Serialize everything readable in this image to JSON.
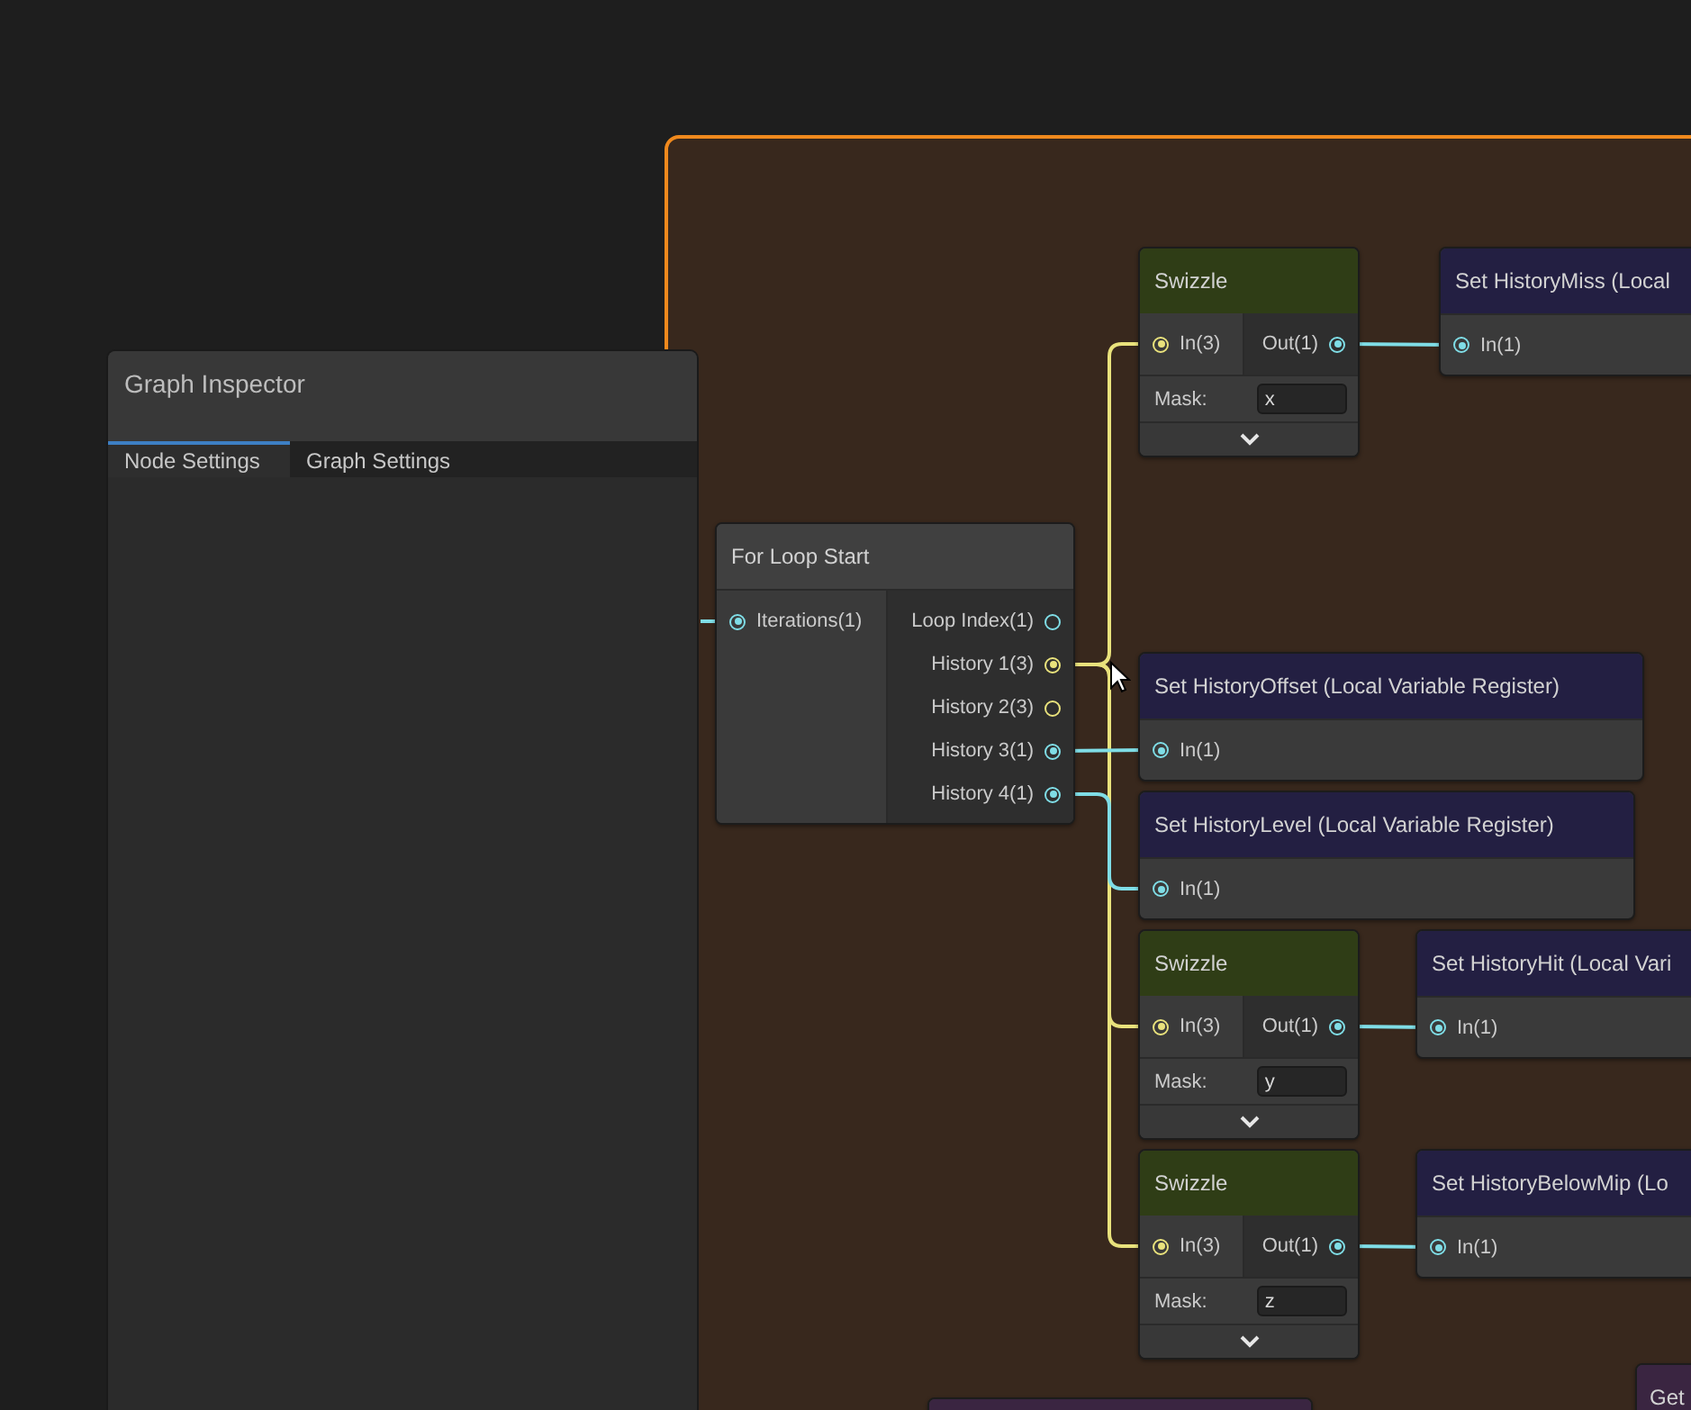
{
  "inspector": {
    "title": "Graph Inspector",
    "tabs": [
      {
        "label": "Node Settings",
        "selected": true
      },
      {
        "label": "Graph Settings",
        "selected": false
      }
    ]
  },
  "nodes": [
    {
      "kind": "swizzle",
      "title": "Swizzle",
      "inputs": [
        {
          "label": "In(3)",
          "color": "#e9e27c",
          "connected": true
        }
      ],
      "outputs": [
        {
          "label": "Out(1)",
          "color": "#7fdde6",
          "connected": true
        }
      ],
      "mask_label": "Mask:",
      "mask_value": "x"
    },
    {
      "kind": "register",
      "title": "Set HistoryMiss (Local",
      "inputs": [
        {
          "label": "In(1)",
          "color": "#7fdde6",
          "connected": true
        }
      ]
    },
    {
      "kind": "loop",
      "title": "For Loop Start",
      "inputs": [
        {
          "label": "Iterations(1)",
          "color": "#7fdde6",
          "connected": true
        }
      ],
      "outputs": [
        {
          "label": "Loop Index(1)",
          "color": "#7fdde6",
          "connected": false
        },
        {
          "label": "History 1(3)",
          "color": "#e9e27c",
          "connected": true
        },
        {
          "label": "History 2(3)",
          "color": "#e9e27c",
          "connected": false
        },
        {
          "label": "History 3(1)",
          "color": "#7fdde6",
          "connected": true
        },
        {
          "label": "History 4(1)",
          "color": "#7fdde6",
          "connected": true
        }
      ]
    },
    {
      "kind": "register",
      "title": "Set HistoryOffset (Local Variable Register)",
      "inputs": [
        {
          "label": "In(1)",
          "color": "#7fdde6",
          "connected": true
        }
      ]
    },
    {
      "kind": "register",
      "title": "Set HistoryLevel (Local Variable Register)",
      "inputs": [
        {
          "label": "In(1)",
          "color": "#7fdde6",
          "connected": true
        }
      ]
    },
    {
      "kind": "swizzle",
      "title": "Swizzle",
      "inputs": [
        {
          "label": "In(3)",
          "color": "#e9e27c",
          "connected": true
        }
      ],
      "outputs": [
        {
          "label": "Out(1)",
          "color": "#7fdde6",
          "connected": true
        }
      ],
      "mask_label": "Mask:",
      "mask_value": "y"
    },
    {
      "kind": "register",
      "title": "Set HistoryHit (Local Vari",
      "inputs": [
        {
          "label": "In(1)",
          "color": "#7fdde6",
          "connected": true
        }
      ]
    },
    {
      "kind": "swizzle",
      "title": "Swizzle",
      "inputs": [
        {
          "label": "In(3)",
          "color": "#e9e27c",
          "connected": true
        }
      ],
      "outputs": [
        {
          "label": "Out(1)",
          "color": "#7fdde6",
          "connected": true
        }
      ],
      "mask_label": "Mask:",
      "mask_value": "z"
    },
    {
      "kind": "register",
      "title": "Set HistoryBelowMip (Lo",
      "inputs": [
        {
          "label": "In(1)",
          "color": "#7fdde6",
          "connected": true
        }
      ]
    },
    {
      "kind": "getter",
      "title": "Get"
    },
    {
      "kind": "stub"
    }
  ]
}
